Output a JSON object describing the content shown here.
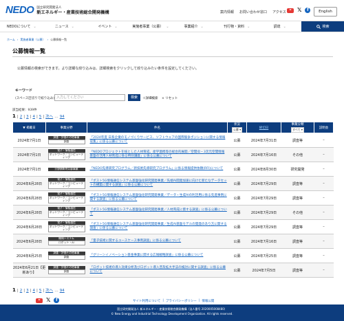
{
  "header": {
    "logo": "NEDO",
    "org_small": "国立研究開発法人",
    "org_main": "新エネルギー・産業技術総合開発機構",
    "links": [
      "案内情報",
      "お問い合わせ窓口",
      "アクセス"
    ],
    "english": "English"
  },
  "nav": {
    "items": [
      "NEDOについて",
      "ニュース",
      "イベント",
      "実施者事業（公募）",
      "事業紹介",
      "刊行物・資料",
      "調達"
    ],
    "search": "検索"
  },
  "breadcrumb": [
    "ホーム",
    "実施者事業（公募）",
    "公募情報一覧"
  ],
  "page_title": "公募情報一覧",
  "description": "公募情報の検索ができます。より詳細な絞り込みは、詳細検索をクリックして絞り込みたい条件を設定してください。",
  "search": {
    "label": "キーワード",
    "sub": "(スペース区切りで絞り込み)",
    "placeholder": "入力してください",
    "button": "検索",
    "detail": "＋詳細検索",
    "reset": "× リセット"
  },
  "result_count": "該当結果：939件",
  "pager": {
    "current": "1",
    "pages": [
      "2",
      "3",
      "4",
      "5"
    ],
    "next": "次へ",
    "last": "94"
  },
  "table": {
    "headers": {
      "date": "▼ 掲載日",
      "type": "事業分野",
      "name": "件名",
      "status": "状況",
      "status_sel": "公募 ▾",
      "deadline": "締切日",
      "category": "事業分類",
      "category_sel": "すべて ▾",
      "notice": "説明会"
    },
    "rows": [
      {
        "date": "2024年7月1日",
        "tag1": "調査・評価その他事業",
        "tag2": "調査",
        "name": "「2024年度 日系企業のモノづくりサービス、ソフトウェアの国際競争ポジションに関する情報収集」に係る公募について",
        "status": "公募",
        "deadline": "2024年7月31日",
        "category": "調査等",
        "notice": "–"
      },
      {
        "date": "2024年7月1日",
        "tag1": "電子・情報通信",
        "tag2": "ネットワーク／コンピューティング",
        "name": "「NEDOプロジェクトを核とした人材育成、産学連携等の総合的展開／空間ID・3次元空間情報基盤の活用人材育成に係る特別講座」に係る公募について",
        "status": "公募",
        "deadline": "2024年7月16日",
        "category": "その他",
        "notice": "–"
      },
      {
        "date": "2024年7月1日",
        "tag1": "分野横断的公募事業",
        "tag2": "",
        "name": "「NEDO先導研究プログラム／新技術先導研究プログラム」に係る情報提供依頼(RFI)について",
        "status": "公募",
        "deadline": "2024年8月30日",
        "category": "研究開発",
        "notice": "–"
      },
      {
        "date": "2024年6月28日",
        "tag1": "電子・情報通信",
        "tag2": "ネットワーク／コンピューティング",
        "name": "「ポスト5G情報通信システム基盤強化研究開発事業／先端AI開発加速に向けた新たなデータセットの構築に関する調査」に係る公募について",
        "status": "公募",
        "deadline": "2024年7月29日",
        "category": "調査等",
        "notice": "–"
      },
      {
        "date": "2024年6月28日",
        "tag1": "電子・情報通信",
        "tag2": "ネットワーク／コンピューティング",
        "name": "「ポスト5G情報通信システム基盤強化研究開発事業／データ・生成AIの利活用に係る先進事例に関する調査」に係る公募について",
        "status": "公募",
        "deadline": "2024年7月29日",
        "category": "調査等",
        "notice": "–"
      },
      {
        "date": "2024年6月28日",
        "tag1": "電子・情報通信",
        "tag2": "ネットワーク／コンピューティング",
        "name": "「ポスト5G情報通信システム基盤強化研究開発事業／人材育成に資する調査」に係る公募について",
        "status": "公募",
        "deadline": "2024年7月29日",
        "category": "その他",
        "notice": "–"
      },
      {
        "date": "2024年6月28日",
        "tag1": "電子・情報通信",
        "tag2": "ネットワーク／コンピューティング",
        "name": "「ポスト5G情報通信システム基盤強化研究開発事業／生成AI基盤モデルの開発のあり方に関する調査」に係る公募について",
        "status": "公募",
        "deadline": "2024年7月29日",
        "category": "調査等",
        "notice": "–"
      },
      {
        "date": "2024年6月28日",
        "tag1": "機械システム",
        "tag2": "ロボット・AI",
        "name": "「量子技術に関するユースケース事例調査」に係る公募について",
        "status": "公募",
        "deadline": "2024年7月16日",
        "category": "調査等",
        "notice": "–"
      },
      {
        "date": "2024年6月25日",
        "tag1": "調査・評価その他事業",
        "tag2": "調査",
        "name": "「グリーンイノベーション基金事業に関する広報戦略調査」に係る公募について",
        "status": "公募",
        "deadline": "2024年7月25日",
        "category": "調査等",
        "notice": "–"
      },
      {
        "date": "2024年6月21日【更新あり】",
        "tag1": "調査・評価その他事業",
        "tag2": "調査",
        "name": "「ロボット技術の導入効果分析及びロボット導入普及拡大手法の検討に関する調査」に係る公募について",
        "status": "公募",
        "deadline": "2024年7月5日",
        "category": "調査等",
        "notice": "–"
      }
    ]
  },
  "footer": {
    "links": [
      "サイト利用について",
      "プライバシーポリシー",
      "情報公開"
    ],
    "org": "国立研究開発法人 新エネルギー・産業技術総合開発機構（法人番号 2020005008480）",
    "copyright": "© New Energy and Industrial Technology Development Organization. All rights reserved."
  },
  "colors": {
    "navy": "#0d3d7e",
    "link": "#1565c0"
  }
}
